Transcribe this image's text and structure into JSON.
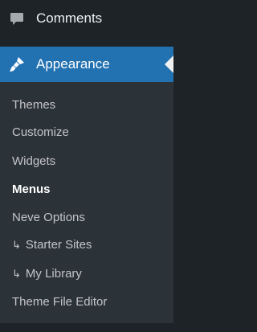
{
  "menu": {
    "comments": {
      "label": "Comments",
      "icon": "comment-bubble-icon"
    },
    "appearance": {
      "label": "Appearance",
      "icon": "paintbrush-icon",
      "active": true
    },
    "submenu": [
      {
        "label": "Themes",
        "prefix": "",
        "current": false
      },
      {
        "label": "Customize",
        "prefix": "",
        "current": false
      },
      {
        "label": "Widgets",
        "prefix": "",
        "current": false
      },
      {
        "label": "Menus",
        "prefix": "",
        "current": true
      },
      {
        "label": "Neve Options",
        "prefix": "",
        "current": false
      },
      {
        "label": "Starter Sites",
        "prefix": "↳",
        "current": false
      },
      {
        "label": "My Library",
        "prefix": "↳",
        "current": false
      },
      {
        "label": "Theme File Editor",
        "prefix": "",
        "current": false
      }
    ]
  },
  "colors": {
    "sidebar_bg": "#1d2327",
    "submenu_bg": "#2c3338",
    "active_bg": "#2271b1",
    "text": "#f0f0f1",
    "submenu_text": "#c3c4c7"
  }
}
